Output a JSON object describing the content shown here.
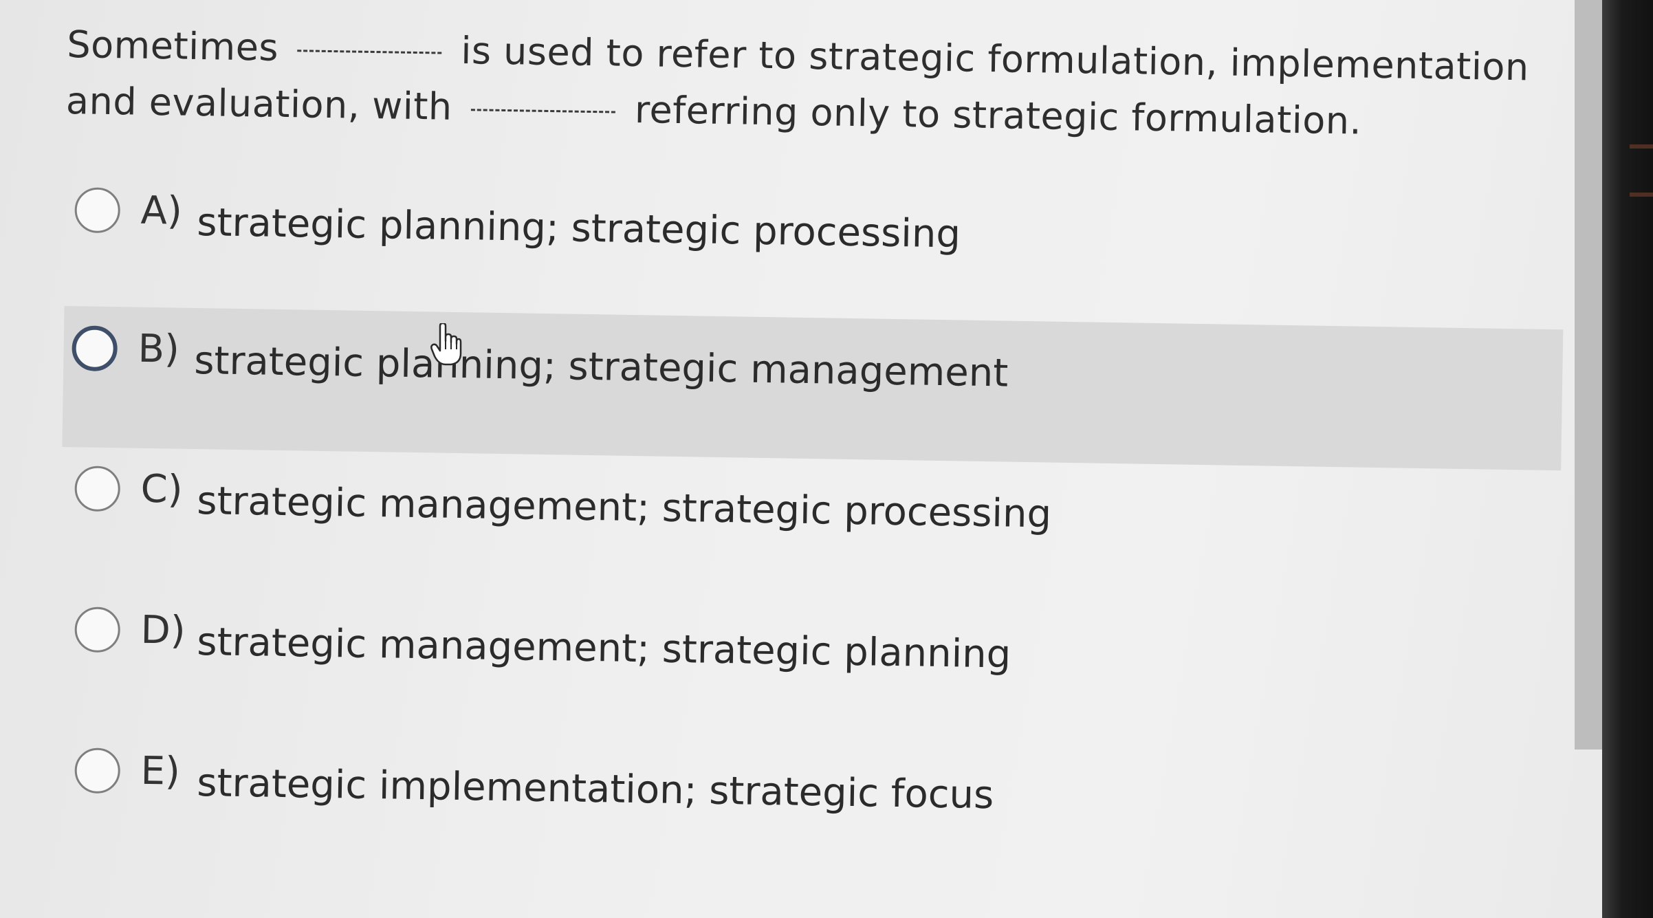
{
  "question": {
    "part1": "Sometimes",
    "part2": "is used to refer to strategic formulation, implementation and evaluation, with",
    "part3": "referring only to strategic formulation."
  },
  "options": [
    {
      "letter": "A)",
      "text": "strategic planning; strategic processing"
    },
    {
      "letter": "B)",
      "text": "strategic planning; strategic management"
    },
    {
      "letter": "C)",
      "text": "strategic management; strategic processing"
    },
    {
      "letter": "D)",
      "text": "strategic management; strategic planning"
    },
    {
      "letter": "E)",
      "text": "strategic implementation; strategic focus"
    }
  ],
  "icons": {
    "cursor": "hand-pointer-icon",
    "radio": "radio-button"
  }
}
